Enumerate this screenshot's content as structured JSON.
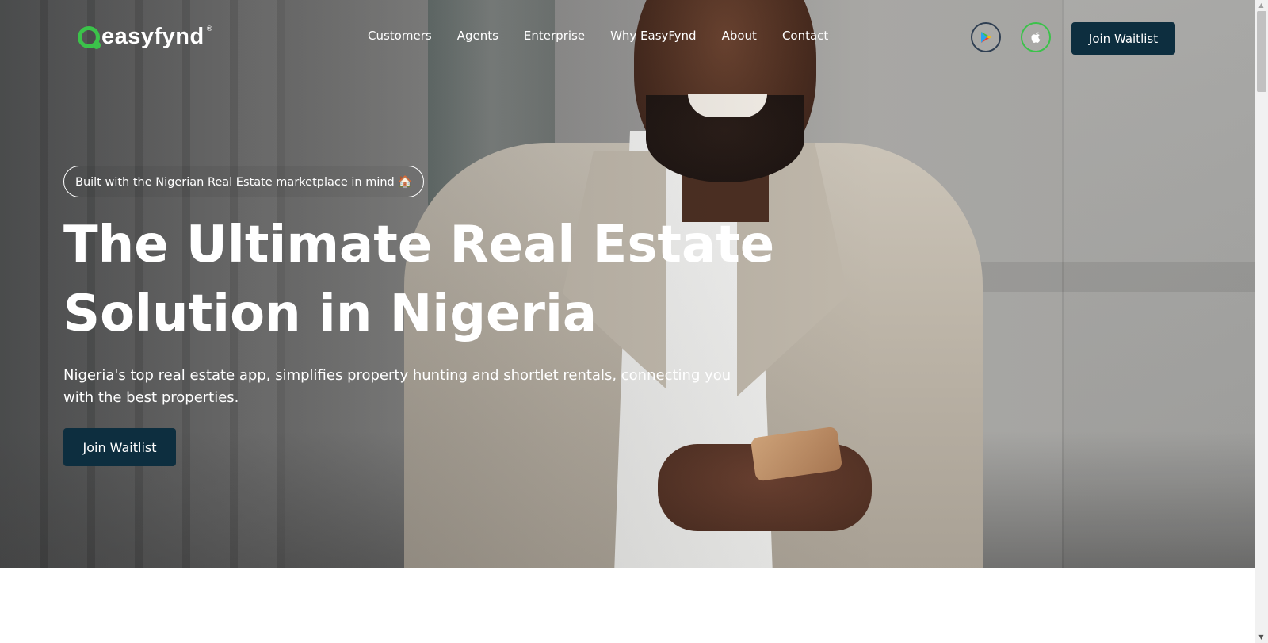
{
  "brand": {
    "name": "easyfynd",
    "reg_mark": "®",
    "accent": "#3bc24a",
    "dark": "#0d2e3f"
  },
  "nav": {
    "items": [
      {
        "label": "Customers"
      },
      {
        "label": "Agents"
      },
      {
        "label": "Enterprise"
      },
      {
        "label": "Why EasyFynd"
      },
      {
        "label": "About"
      },
      {
        "label": "Contact"
      }
    ],
    "store_icons": [
      "google-play-icon",
      "apple-icon"
    ],
    "cta_label": "Join Waitlist"
  },
  "hero": {
    "pill_text": "Built with the Nigerian Real Estate marketplace in mind 🏠",
    "headline_line1": "The Ultimate Real Estate",
    "headline_line2": "Solution in Nigeria",
    "subtext": "Nigeria's top real estate app, simplifies property hunting and shortlet rentals, connecting you with the best properties.",
    "cta_label": "Join Waitlist"
  },
  "scrollbar": {
    "up_arrow": "▲",
    "down_arrow": "▼"
  }
}
